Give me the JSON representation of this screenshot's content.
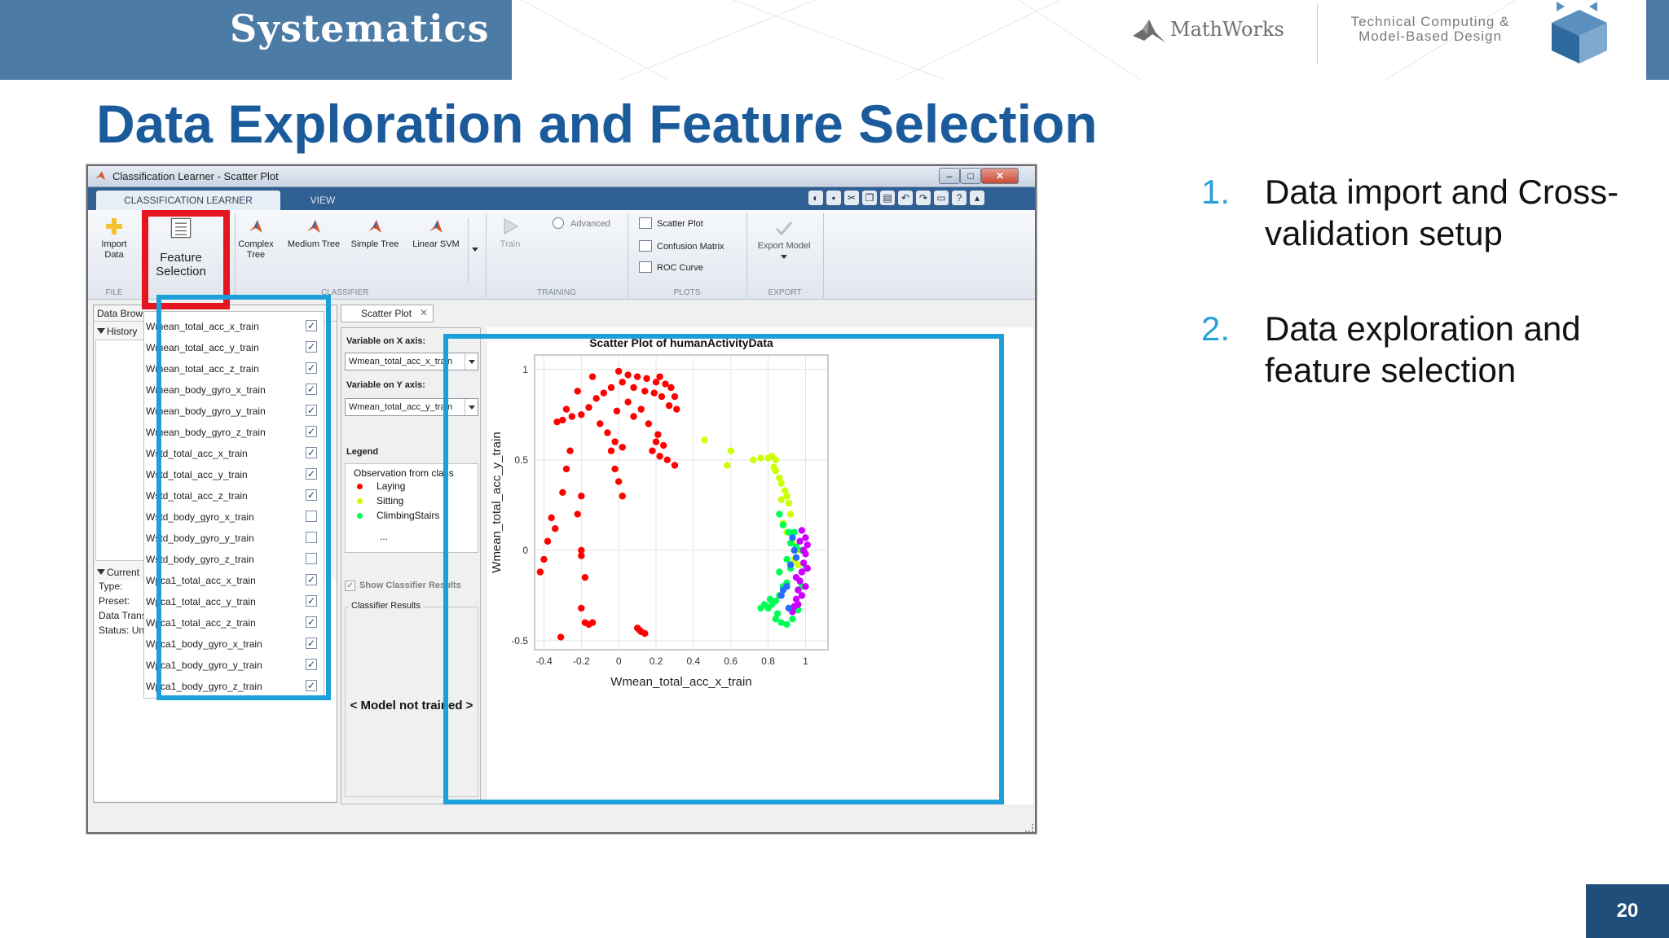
{
  "header": {
    "brand": "Systematics",
    "partner": "MathWorks",
    "tagline": "Technical Computing & Model-Based Design"
  },
  "slide": {
    "title": "Data Exploration and Feature Selection",
    "page_number": "20",
    "bullets": [
      {
        "num": "1.",
        "text": "Data import and Cross-validation setup"
      },
      {
        "num": "2.",
        "text": "Data exploration and feature selection"
      }
    ]
  },
  "app": {
    "window_title": "Classification Learner - Scatter Plot",
    "tabs": [
      "CLASSIFICATION LEARNER",
      "VIEW"
    ],
    "toolstrip": {
      "import_data": "Import Data",
      "feature_selection": "Feature Selection",
      "classifiers": [
        "Complex Tree",
        "Medium Tree",
        "Simple Tree",
        "Linear SVM"
      ],
      "advanced": "Advanced",
      "train": "Train",
      "plots": [
        "Scatter Plot",
        "Confusion Matrix",
        "ROC Curve"
      ],
      "export_model": "Export Model",
      "sections": {
        "file": "FILE",
        "classifier": "CLASSIFIER",
        "training": "TRAINING",
        "plots": "PLOTS",
        "export": "EXPORT"
      }
    },
    "data_browser": {
      "header": "Data Browser",
      "history": "History",
      "current": "Current",
      "current_lines": [
        "Type:",
        "Preset:",
        "Data Transf",
        "Status: Untrained"
      ]
    },
    "features": [
      {
        "name": "Wmean_total_acc_x_train",
        "checked": true
      },
      {
        "name": "Wmean_total_acc_y_train",
        "checked": true
      },
      {
        "name": "Wmean_total_acc_z_train",
        "checked": true
      },
      {
        "name": "Wmean_body_gyro_x_train",
        "checked": true
      },
      {
        "name": "Wmean_body_gyro_y_train",
        "checked": true
      },
      {
        "name": "Wmean_body_gyro_z_train",
        "checked": true
      },
      {
        "name": "Wstd_total_acc_x_train",
        "checked": true
      },
      {
        "name": "Wstd_total_acc_y_train",
        "checked": true
      },
      {
        "name": "Wstd_total_acc_z_train",
        "checked": true
      },
      {
        "name": "Wstd_body_gyro_x_train",
        "checked": false
      },
      {
        "name": "Wstd_body_gyro_y_train",
        "checked": false
      },
      {
        "name": "Wstd_body_gyro_z_train",
        "checked": false
      },
      {
        "name": "Wpca1_total_acc_x_train",
        "checked": true
      },
      {
        "name": "Wpca1_total_acc_y_train",
        "checked": true
      },
      {
        "name": "Wpca1_total_acc_z_train",
        "checked": true
      },
      {
        "name": "Wpca1_body_gyro_x_train",
        "checked": true
      },
      {
        "name": "Wpca1_body_gyro_y_train",
        "checked": true
      },
      {
        "name": "Wpca1_body_gyro_z_train",
        "checked": true
      }
    ],
    "scatter_tab": "Scatter Plot",
    "x_axis_label": "Variable on X axis:",
    "x_axis_value": "Wmean_total_acc_x_train",
    "y_axis_label": "Variable on Y axis:",
    "y_axis_value": "Wmean_total_acc_y_train",
    "legend_label": "Legend",
    "legend_title": "Observation from class",
    "legend_items": [
      {
        "name": "Laying",
        "color": "#ff0000"
      },
      {
        "name": "Sitting",
        "color": "#ccff00"
      },
      {
        "name": "ClimbingStairs",
        "color": "#00ff55"
      }
    ],
    "legend_more": "...",
    "show_results": "Show Classifier Results",
    "classifier_results": "Classifier Results",
    "model_status": "< Model not trained >"
  },
  "chart_data": {
    "type": "scatter",
    "title": "Scatter Plot of humanActivityData",
    "xlabel": "Wmean_total_acc_x_train",
    "ylabel": "Wmean_total_acc_y_train",
    "xlim": [
      -0.45,
      1.12
    ],
    "ylim": [
      -0.55,
      1.08
    ],
    "xticks": [
      -0.4,
      -0.2,
      0,
      0.2,
      0.4,
      0.6,
      0.8,
      1
    ],
    "yticks": [
      -0.5,
      0,
      0.5,
      1
    ],
    "grid": true,
    "series": [
      {
        "name": "Laying",
        "color": "#ff0000",
        "points": [
          [
            0.0,
            0.99
          ],
          [
            0.05,
            0.97
          ],
          [
            0.1,
            0.96
          ],
          [
            0.15,
            0.95
          ],
          [
            0.2,
            0.93
          ],
          [
            0.25,
            0.92
          ],
          [
            0.02,
            0.93
          ],
          [
            -0.04,
            0.9
          ],
          [
            -0.08,
            0.87
          ],
          [
            -0.12,
            0.84
          ],
          [
            -0.16,
            0.79
          ],
          [
            -0.2,
            0.75
          ],
          [
            -0.25,
            0.74
          ],
          [
            -0.3,
            0.72
          ],
          [
            -0.33,
            0.71
          ],
          [
            0.08,
            0.9
          ],
          [
            0.14,
            0.88
          ],
          [
            0.19,
            0.87
          ],
          [
            0.23,
            0.85
          ],
          [
            0.27,
            0.8
          ],
          [
            0.31,
            0.78
          ],
          [
            -0.1,
            0.7
          ],
          [
            -0.06,
            0.65
          ],
          [
            -0.02,
            0.6
          ],
          [
            0.02,
            0.57
          ],
          [
            -0.04,
            0.55
          ],
          [
            -0.02,
            0.45
          ],
          [
            0.0,
            0.38
          ],
          [
            0.02,
            0.3
          ],
          [
            0.2,
            0.6
          ],
          [
            0.18,
            0.55
          ],
          [
            0.22,
            0.52
          ],
          [
            0.26,
            0.5
          ],
          [
            0.3,
            0.47
          ],
          [
            0.21,
            0.64
          ],
          [
            0.24,
            0.58
          ],
          [
            -0.26,
            0.55
          ],
          [
            -0.28,
            0.45
          ],
          [
            -0.3,
            0.32
          ],
          [
            -0.36,
            0.18
          ],
          [
            -0.34,
            0.12
          ],
          [
            -0.38,
            0.05
          ],
          [
            -0.4,
            -0.05
          ],
          [
            -0.42,
            -0.12
          ],
          [
            -0.2,
            0.3
          ],
          [
            -0.22,
            0.2
          ],
          [
            -0.2,
            0.0
          ],
          [
            -0.2,
            -0.03
          ],
          [
            -0.18,
            -0.15
          ],
          [
            -0.2,
            -0.32
          ],
          [
            -0.18,
            -0.4
          ],
          [
            -0.16,
            -0.41
          ],
          [
            -0.14,
            -0.4
          ],
          [
            -0.31,
            -0.48
          ],
          [
            0.1,
            -0.43
          ],
          [
            0.12,
            -0.45
          ],
          [
            0.14,
            -0.46
          ],
          [
            0.11,
            -0.44
          ],
          [
            0.05,
            0.82
          ],
          [
            0.12,
            0.78
          ],
          [
            0.08,
            0.74
          ],
          [
            -0.01,
            0.77
          ],
          [
            0.16,
            0.7
          ],
          [
            0.3,
            0.85
          ],
          [
            0.28,
            0.9
          ],
          [
            0.22,
            0.96
          ],
          [
            -0.14,
            0.96
          ],
          [
            -0.22,
            0.88
          ],
          [
            -0.28,
            0.78
          ]
        ]
      },
      {
        "name": "Sitting",
        "color": "#ccff00",
        "points": [
          [
            0.46,
            0.61
          ],
          [
            0.6,
            0.55
          ],
          [
            0.72,
            0.5
          ],
          [
            0.76,
            0.51
          ],
          [
            0.8,
            0.51
          ],
          [
            0.82,
            0.52
          ],
          [
            0.84,
            0.5
          ],
          [
            0.83,
            0.46
          ],
          [
            0.86,
            0.4
          ],
          [
            0.87,
            0.37
          ],
          [
            0.89,
            0.33
          ],
          [
            0.9,
            0.3
          ],
          [
            0.91,
            0.26
          ],
          [
            0.92,
            0.2
          ],
          [
            0.88,
            0.15
          ],
          [
            0.9,
            0.1
          ],
          [
            0.93,
            0.05
          ],
          [
            0.95,
            0.0
          ],
          [
            0.94,
            -0.05
          ],
          [
            0.96,
            -0.08
          ],
          [
            0.58,
            0.47
          ],
          [
            0.84,
            0.44
          ],
          [
            0.87,
            0.28
          ]
        ]
      },
      {
        "name": "ClimbingStairs",
        "color": "#00ff55",
        "points": [
          [
            0.86,
            0.2
          ],
          [
            0.88,
            0.14
          ],
          [
            0.91,
            0.1
          ],
          [
            0.92,
            0.04
          ],
          [
            0.95,
            0.02
          ],
          [
            0.92,
            -0.1
          ],
          [
            0.9,
            -0.18
          ],
          [
            0.88,
            -0.2
          ],
          [
            0.86,
            -0.25
          ],
          [
            0.84,
            -0.28
          ],
          [
            0.82,
            -0.3
          ],
          [
            0.8,
            -0.32
          ],
          [
            0.78,
            -0.3
          ],
          [
            0.76,
            -0.32
          ],
          [
            0.84,
            -0.38
          ],
          [
            0.87,
            -0.4
          ],
          [
            0.9,
            -0.41
          ],
          [
            0.93,
            -0.38
          ],
          [
            0.96,
            -0.33
          ],
          [
            0.98,
            -0.2
          ],
          [
            1.0,
            -0.1
          ],
          [
            0.98,
            0.0
          ],
          [
            0.94,
            0.1
          ],
          [
            0.85,
            -0.35
          ],
          [
            0.81,
            -0.27
          ],
          [
            0.86,
            -0.12
          ],
          [
            0.9,
            -0.05
          ]
        ]
      },
      {
        "name": "",
        "color": "#cc00ff",
        "points": [
          [
            0.98,
            0.11
          ],
          [
            1.0,
            0.07
          ],
          [
            1.01,
            0.03
          ],
          [
            1.0,
            -0.02
          ],
          [
            0.99,
            -0.07
          ],
          [
            0.98,
            -0.12
          ],
          [
            0.97,
            -0.17
          ],
          [
            0.96,
            -0.22
          ],
          [
            0.95,
            -0.27
          ],
          [
            0.94,
            -0.31
          ],
          [
            0.93,
            -0.34
          ],
          [
            0.96,
            -0.3
          ],
          [
            1.0,
            -0.2
          ],
          [
            1.01,
            -0.1
          ],
          [
            0.99,
            0.0
          ],
          [
            0.97,
            0.05
          ],
          [
            0.98,
            -0.25
          ],
          [
            0.95,
            -0.15
          ]
        ]
      },
      {
        "name": "",
        "color": "#2a6cff",
        "points": [
          [
            0.93,
            0.07
          ],
          [
            0.94,
            0.0
          ],
          [
            0.9,
            -0.2
          ],
          [
            0.87,
            -0.25
          ],
          [
            0.91,
            -0.32
          ],
          [
            0.92,
            -0.08
          ],
          [
            0.95,
            -0.04
          ],
          [
            0.88,
            -0.22
          ]
        ]
      }
    ]
  }
}
